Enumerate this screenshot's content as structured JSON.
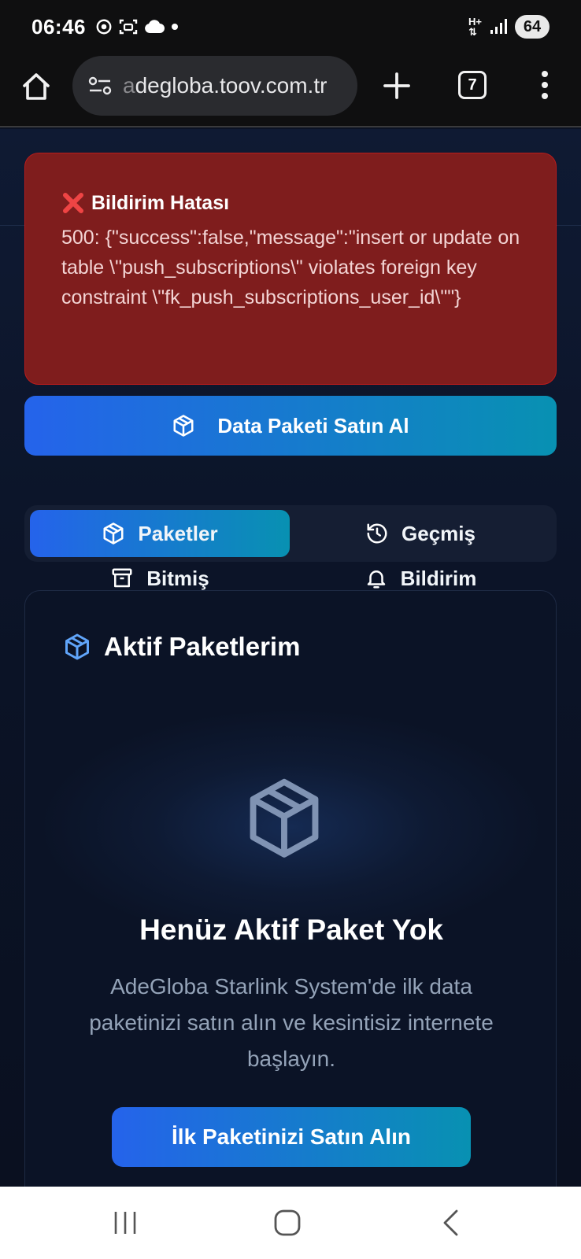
{
  "status_bar": {
    "time": "06:46",
    "network": "H+",
    "battery": "64"
  },
  "browser": {
    "url_faded": "a",
    "url": "degloba.toov.com.tr",
    "tab_count": "7"
  },
  "error": {
    "title": "Bildirim Hatası",
    "message": "500: {\"success\":false,\"message\":\"insert or update on table \\\"push_subscriptions\\\" violates foreign key constraint \\\"fk_push_subscriptions_user_id\\\"\"}"
  },
  "buy_button": {
    "label": "Data Paketi Satın Al"
  },
  "tabs": [
    {
      "label": "Paketler",
      "icon": "package-icon",
      "active": true
    },
    {
      "label": "Geçmiş",
      "icon": "history-icon",
      "active": false
    },
    {
      "label": "Bitmiş",
      "icon": "archive-icon",
      "active": false
    },
    {
      "label": "Bildirim",
      "icon": "bell-icon",
      "active": false
    }
  ],
  "card": {
    "title": "Aktif Paketlerim",
    "empty_title": "Henüz Aktif Paket Yok",
    "empty_desc": "AdeGloba Starlink System'de ilk data paketinizi satın alın ve kesintisiz internete başlayın.",
    "cta_label": "İlk Paketinizi Satın Alın"
  },
  "colors": {
    "error_bg": "#7f1d1d",
    "accent_start": "#2563eb",
    "accent_end": "#0891b2",
    "page_bg": "#0b1326"
  }
}
